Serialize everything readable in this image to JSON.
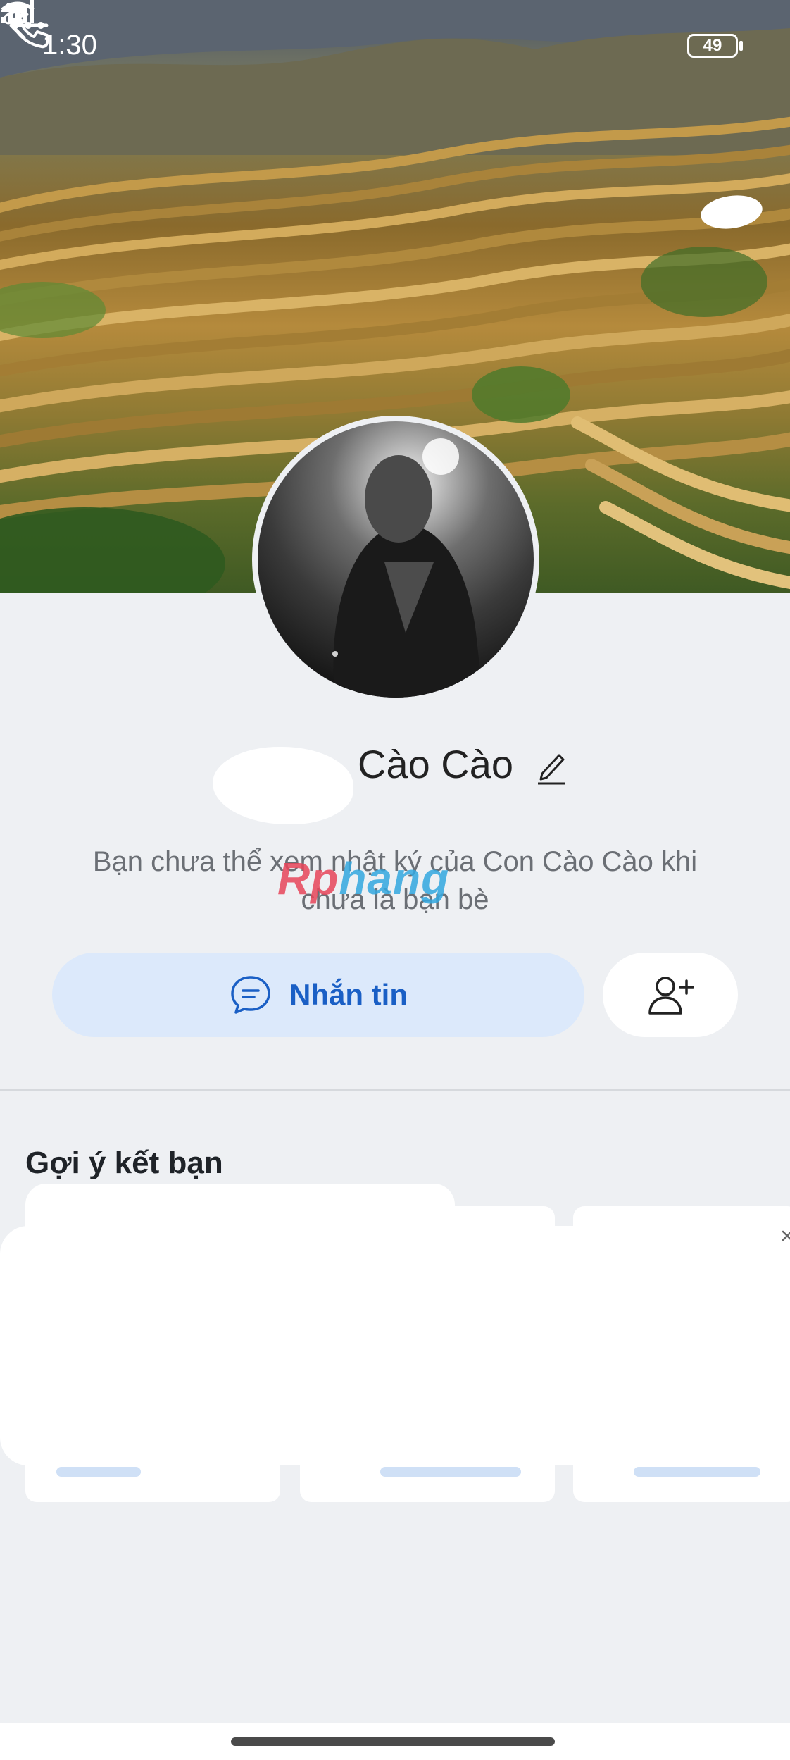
{
  "status_bar": {
    "time": "1:30",
    "battery": "49"
  },
  "header": {
    "back_icon": "arrow-left-icon",
    "call_icon": "phone-icon",
    "more_icon": "more-dots-icon"
  },
  "profile": {
    "name": "Cào Cào",
    "notice": "Bạn chưa thể xem nhật ký của Con Cào Cào khi chưa là bạn bè",
    "watermark_part1": "Rp",
    "watermark_part2": "hang"
  },
  "actions": {
    "message_label": "Nhắn tin"
  },
  "suggestions": {
    "title": "Gợi ý kết bạn"
  }
}
